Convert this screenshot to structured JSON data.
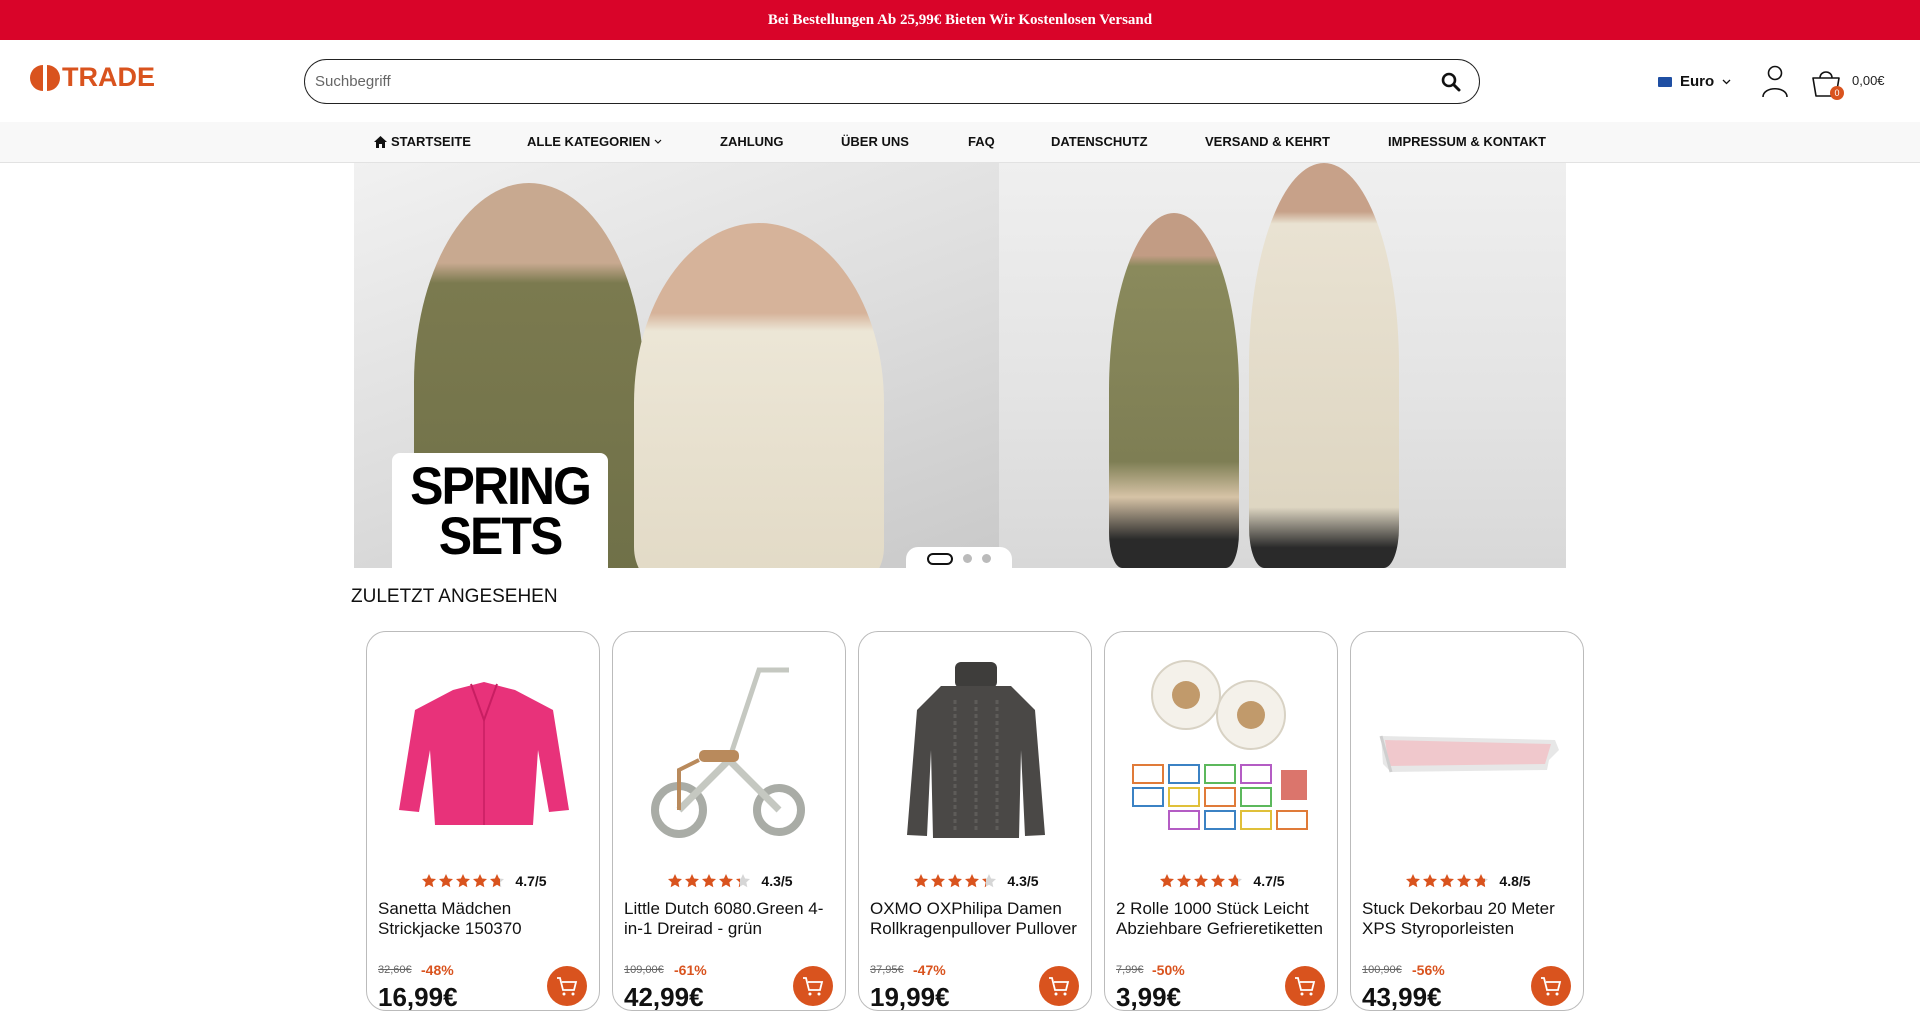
{
  "announcement": "Bei Bestellungen Ab 25,99€ Bieten Wir Kostenlosen Versand",
  "brand": {
    "logo_text": "TRADE",
    "accent_color": "#d9531e",
    "banner_color": "#d90429"
  },
  "search": {
    "placeholder": "Suchbegriff"
  },
  "header": {
    "currency": "Euro",
    "cart_count": "0",
    "cart_total": "0,00€"
  },
  "nav": {
    "home": "STARTSEITE",
    "categories": "ALLE KATEGORIEN",
    "payment": "ZAHLUNG",
    "about": "ÜBER UNS",
    "faq": "FAQ",
    "privacy": "DATENSCHUTZ",
    "shipping": "VERSAND & KEHRT",
    "imprint": "IMPRESSUM & KONTAKT"
  },
  "hero": {
    "line1": "SPRING",
    "line2": "SETS",
    "slide_count": 3,
    "active_slide": 1
  },
  "recently_viewed": {
    "title": "ZULETZT ANGESEHEN",
    "products": [
      {
        "rating": 4.7,
        "rating_text": "4.7/5",
        "title": "Sanetta Mädchen Strickjacke 150370",
        "old_price": "32,60€",
        "discount": "-48%",
        "price": "16,99€",
        "image": "pink-cardigan"
      },
      {
        "rating": 4.3,
        "rating_text": "4.3/5",
        "title": "Little Dutch 6080.Green 4-in-1 Dreirad - grün",
        "old_price": "109,00€",
        "discount": "-61%",
        "price": "42,99€",
        "image": "tricycle"
      },
      {
        "rating": 4.3,
        "rating_text": "4.3/5",
        "title": "OXMO OXPhilipa Damen Rollkragenpullover Pullover",
        "old_price": "37,95€",
        "discount": "-47%",
        "price": "19,99€",
        "image": "grey-turtleneck"
      },
      {
        "rating": 4.7,
        "rating_text": "4.7/5",
        "title": "2 Rolle 1000 Stück Leicht Abziehbare Gefrieretiketten",
        "old_price": "7,99€",
        "discount": "-50%",
        "price": "3,99€",
        "image": "label-rolls"
      },
      {
        "rating": 4.8,
        "rating_text": "4.8/5",
        "title": "Stuck Dekorbau 20 Meter XPS Styroporleisten",
        "old_price": "100,90€",
        "discount": "-56%",
        "price": "43,99€",
        "image": "cornice-molding"
      }
    ]
  }
}
